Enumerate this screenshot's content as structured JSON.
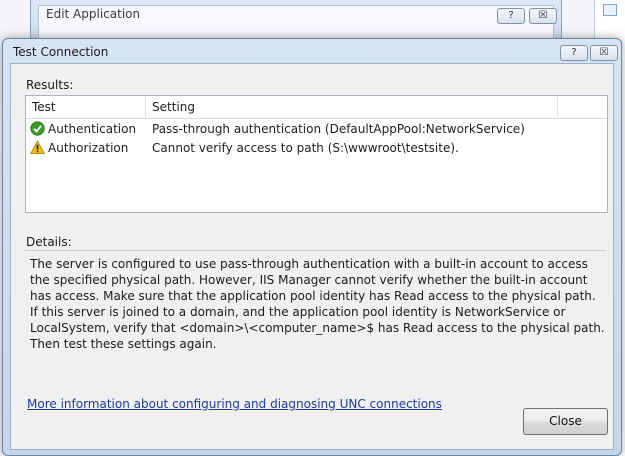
{
  "background_window": {
    "title": "Edit Application",
    "help_label": "?",
    "close_label": "☒"
  },
  "dialog": {
    "title": "Test Connection",
    "help_label": "?",
    "close_label": "☒",
    "results_label": "Results:",
    "columns": [
      "Test",
      "Setting"
    ],
    "rows": [
      {
        "test": "Authentication",
        "setting": "Pass-through authentication (DefaultAppPool:NetworkService)",
        "status": "success",
        "icon": "check-circle-icon"
      },
      {
        "test": "Authorization",
        "setting": "Cannot verify access to path (S:\\wwwroot\\testsite).",
        "status": "warning",
        "icon": "warning-triangle-icon"
      }
    ],
    "details_label": "Details:",
    "details_text": "The server is configured to use pass-through authentication with a built-in account to access the specified physical path. However, IIS Manager cannot verify whether the built-in account has access. Make sure that the application pool identity has Read access to the physical path. If this server is joined to a domain, and the application pool identity is NetworkService or LocalSystem, verify that <domain>\\<computer_name>$ has Read access to the physical path. Then test these settings again.",
    "link_text": "More information about configuring and diagnosing UNC connections",
    "close_button": "Close"
  },
  "colors": {
    "success": "#3c9a2a",
    "warning": "#e8b416",
    "link": "#1c3c9b"
  }
}
